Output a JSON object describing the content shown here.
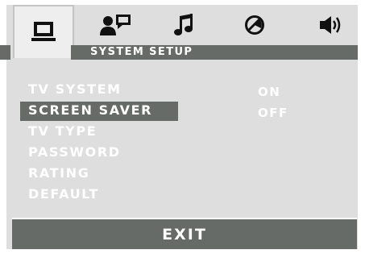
{
  "tabs": [
    {
      "icon": "monitor-icon",
      "active": true
    },
    {
      "icon": "person-speech-icon",
      "active": false
    },
    {
      "icon": "music-note-icon",
      "active": false
    },
    {
      "icon": "rating-circle-icon",
      "active": false
    },
    {
      "icon": "speaker-icon",
      "active": false
    }
  ],
  "header": {
    "title": "SYSTEM SETUP"
  },
  "menu": {
    "items": [
      {
        "label": "TV SYSTEM"
      },
      {
        "label": "SCREEN SAVER",
        "selected": true
      },
      {
        "label": "TV TYPE"
      },
      {
        "label": "PASSWORD"
      },
      {
        "label": "RATING"
      },
      {
        "label": "DEFAULT"
      }
    ]
  },
  "options": [
    "ON",
    "OFF"
  ],
  "footer": {
    "exit_label": "EXIT"
  },
  "colors": {
    "background": "#dedede",
    "bar": "#666b68",
    "active_tab": "#eeeeee",
    "text": "#ffffff",
    "icon": "#111111"
  }
}
